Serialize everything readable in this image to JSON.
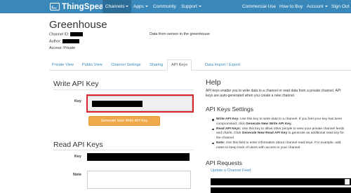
{
  "navbar": {
    "brand": "ThingSpeak",
    "brand_tm": "™",
    "left_items": [
      {
        "label": "Channels",
        "has_caret": true,
        "active": true
      },
      {
        "label": "Apps",
        "has_caret": true,
        "active": false
      },
      {
        "label": "Community",
        "has_caret": false,
        "active": false
      },
      {
        "label": "Support",
        "has_caret": true,
        "active": false
      }
    ],
    "right_items": [
      {
        "label": "Commercial Use",
        "has_caret": false
      },
      {
        "label": "How to Buy",
        "has_caret": false
      },
      {
        "label": "Account",
        "has_caret": true
      },
      {
        "label": "Sign Out",
        "has_caret": false
      }
    ]
  },
  "channel": {
    "title": "Greenhouse",
    "id_label": "Channel ID:",
    "author_label": "Author:",
    "access": "Access: Private",
    "description": "Data from sensor in the greenhouse"
  },
  "tabs": [
    {
      "label": "Private View",
      "active": false
    },
    {
      "label": "Public View",
      "active": false
    },
    {
      "label": "Channel Settings",
      "active": false
    },
    {
      "label": "Sharing",
      "active": false
    },
    {
      "label": "API Keys",
      "active": true
    },
    {
      "label": "Data Import / Export",
      "active": false
    }
  ],
  "write_api": {
    "heading": "Write API Key",
    "key_label": "Key",
    "button": "Generate New Write API Key"
  },
  "read_api": {
    "heading": "Read API Keys",
    "key_label": "Key",
    "note_label": "Note"
  },
  "help": {
    "heading": "Help",
    "intro": "API keys enable you to write data to a channel or read data from a private channel. API keys are auto-generated when you create a new channel.",
    "settings_heading": "API Keys Settings",
    "bullets": [
      {
        "term": "Write API Key:",
        "text": " Use this key to write data to a channel. If you feel your key has been compromised, click ",
        "strong": "Generate New Write API Key.",
        "after": ""
      },
      {
        "term": "Read API Keys:",
        "text": " Use this key to allow other people to view your private channel feeds and charts. Click ",
        "strong": "Generate New Read API Key",
        "after": " to generate an additional read key for the channel."
      },
      {
        "term": "Note:",
        "text": " Use this field to enter information about channel read keys. For example, add notes to keep track of users with access to your channel.",
        "strong": "",
        "after": ""
      }
    ],
    "requests_heading": "API Requests",
    "update_link": "Update a Channel Feed"
  },
  "colors": {
    "navbar": "#3a88b9",
    "navbar_active": "#2c6d97",
    "highlight": "#d9232d",
    "button": "#f0a94a",
    "link": "#3a88b9"
  }
}
